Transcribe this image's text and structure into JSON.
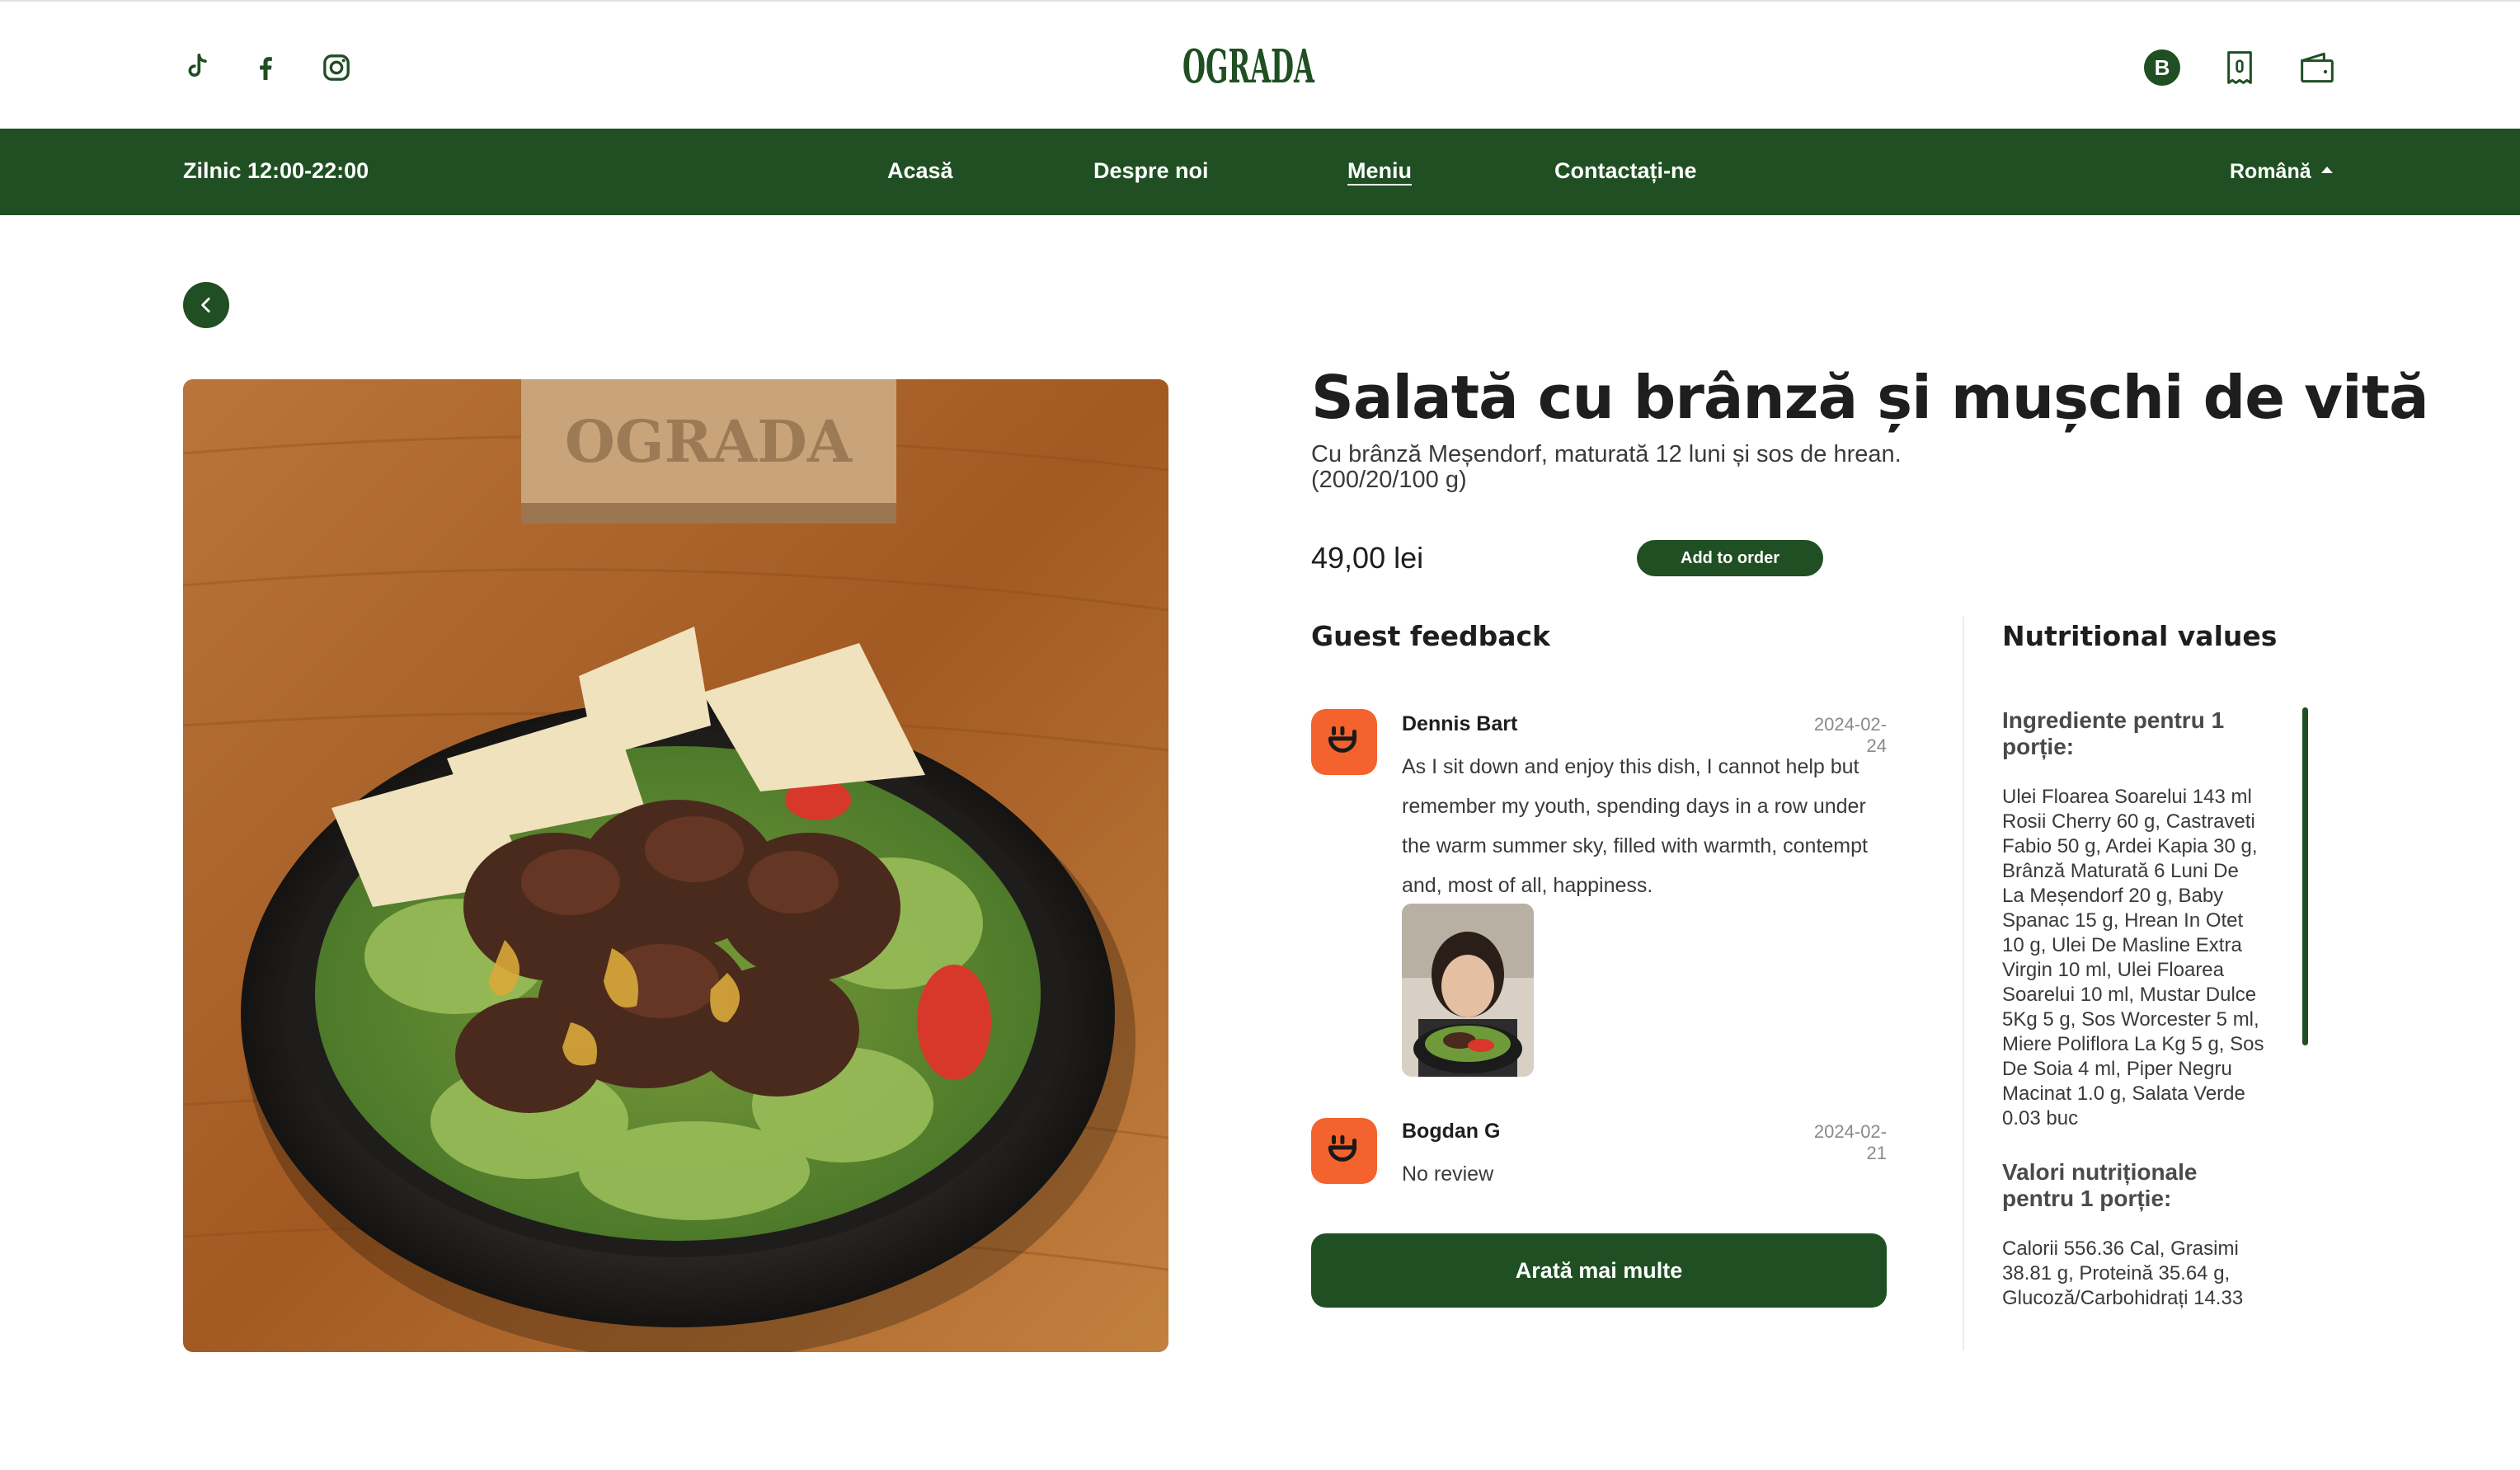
{
  "header": {
    "social": [
      {
        "name": "tiktok-icon"
      },
      {
        "name": "facebook-icon"
      },
      {
        "name": "instagram-icon"
      }
    ],
    "logo_text": "OGRADA",
    "user_badge": "B",
    "icons": [
      "receipt-icon",
      "wallet-icon"
    ]
  },
  "nav": {
    "hours": "Zilnic 12:00-22:00",
    "links": [
      "Acasă",
      "Despre noi",
      "Meniu",
      "Contactați-ne"
    ],
    "active_link": "Meniu",
    "language": "Română"
  },
  "product": {
    "title": "Salată cu brânză și mușchi de vită",
    "description": "Cu brânză Meșendorf, maturată 12 luni și sos de hrean. (200/20/100 g)",
    "price": "49,00 lei",
    "add_button": "Add to order"
  },
  "feedback": {
    "heading": "Guest feedback",
    "reviews": [
      {
        "name": "Dennis Bart",
        "date": "2024-02-24",
        "text": "As I sit down and enjoy this dish, I cannot help but remember my youth, spending days in a row under the warm summer sky, filled with warmth, contempt and, most of all, happiness."
      },
      {
        "name": "Bogdan G",
        "date": "2024-02-21",
        "text": "No review"
      }
    ],
    "more_button": "Arată mai multe"
  },
  "nutrition": {
    "heading": "Nutritional values",
    "ingredients_heading": "Ingrediente pentru 1 porție:",
    "ingredients": "Ulei Floarea Soarelui 143 ml  Rosii Cherry 60 g, Castraveti Fabio 50 g, Ardei Kapia 30 g, Brânză Maturată 6 Luni De La Meșendorf 20 g, Baby Spanac 15 g, Hrean In Otet 10 g, Ulei De Masline Extra Virgin 10 ml, Ulei Floarea Soarelui 10 ml, Mustar Dulce 5Kg 5 g, Sos Worcester 5 ml, Miere Poliflora La Kg 5 g, Sos De Soia 4 ml, Piper Negru Macinat 1.0 g, Salata Verde 0.03 buc",
    "values_heading": "Valori nutriționale pentru 1 porție:",
    "values": "Calorii 556.36 Cal, Grasimi 38.81 g, Proteină 35.64 g, Glucoză/Carbohidrați 14.33"
  },
  "colors": {
    "brand_green": "#1f4f22",
    "accent_orange": "#f4622d"
  }
}
